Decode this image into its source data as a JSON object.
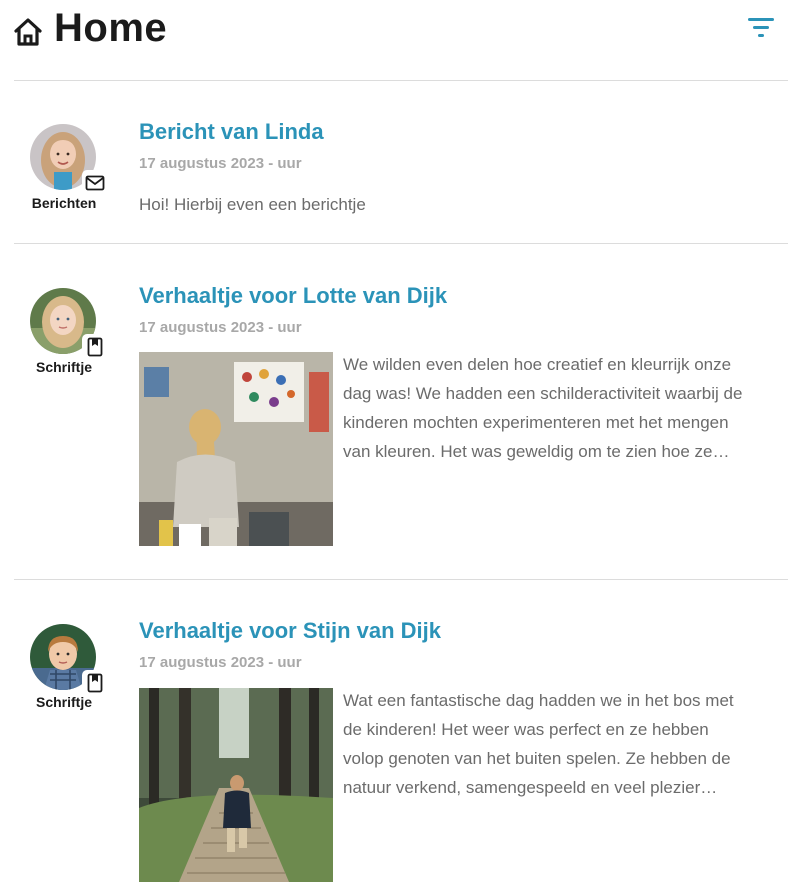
{
  "header": {
    "title": "Home",
    "home_icon": "home-icon",
    "filter_icon": "filter-icon",
    "accent": "#2b93b8"
  },
  "feed": [
    {
      "category": "Berichten",
      "badge_icon": "envelope-icon",
      "title": "Bericht van Linda",
      "date": "17 augustus 2023 - uur",
      "text": "Hoi! Hierbij even een berichtje"
    },
    {
      "category": "Schriftje",
      "badge_icon": "bookmark-icon",
      "title": "Verhaaltje voor Lotte van Dijk",
      "date": "17 augustus 2023 - uur",
      "excerpt": "We wilden even delen hoe creatief en kleurrijk onze dag was! We hadden een schilderactiviteit waarbij de kinderen mochten experimenteren met het mengen van kleuren. Het was geweldig om te zien hoe ze genoten."
    },
    {
      "category": "Schriftje",
      "badge_icon": "bookmark-icon",
      "title": "Verhaaltje voor Stijn van Dijk",
      "date": "17 augustus 2023 - uur",
      "excerpt": "Wat een fantastische dag hadden we in het bos met de kinderen! Het weer was perfect en ze hebben volop genoten van het buiten spelen. Ze hebben de natuur verkend, samengespeeld en veel plezier gehad."
    }
  ]
}
